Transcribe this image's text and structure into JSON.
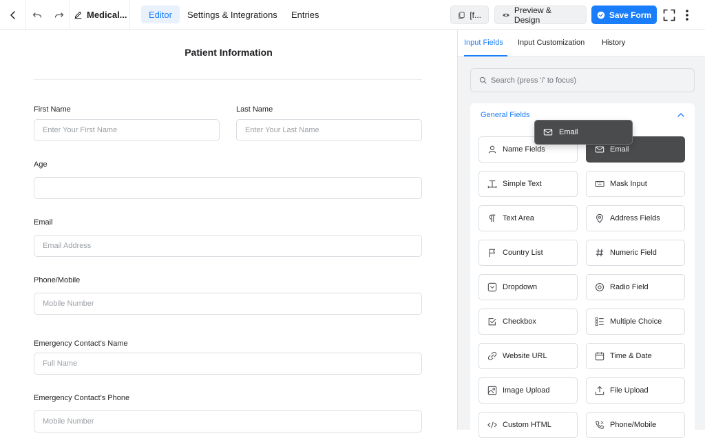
{
  "header": {
    "form_name": "Medical...",
    "tabs": [
      {
        "label": "Editor",
        "active": true
      },
      {
        "label": "Settings & Integrations",
        "active": false
      },
      {
        "label": "Entries",
        "active": false
      }
    ],
    "shortcode_label": "[f...",
    "preview_label": "Preview & Design",
    "save_label": "Save Form"
  },
  "form": {
    "title": "Patient Information",
    "fields": {
      "first_name": {
        "label": "First Name",
        "placeholder": "Enter Your First Name"
      },
      "last_name": {
        "label": "Last Name",
        "placeholder": "Enter Your Last Name"
      },
      "age": {
        "label": "Age",
        "placeholder": ""
      },
      "email": {
        "label": "Email",
        "placeholder": "Email Address"
      },
      "phone": {
        "label": "Phone/Mobile",
        "placeholder": "Mobile Number"
      },
      "emergency_name": {
        "label": "Emergency Contact's Name",
        "placeholder": "Full Name"
      },
      "emergency_phone": {
        "label": "Emergency Contact's Phone",
        "placeholder": "Mobile Number"
      }
    }
  },
  "panel": {
    "tabs": [
      {
        "label": "Input Fields",
        "active": true
      },
      {
        "label": "Input Customization",
        "active": false
      },
      {
        "label": "History",
        "active": false
      }
    ],
    "search_placeholder": "Search (press '/' to focus)",
    "group_title": "General Fields",
    "drag_ghost_label": "Email",
    "fields": [
      {
        "label": "Name Fields",
        "icon": "user-icon"
      },
      {
        "label": "Email",
        "icon": "envelope-icon",
        "selected": true
      },
      {
        "label": "Simple Text",
        "icon": "text-cursor-icon"
      },
      {
        "label": "Mask Input",
        "icon": "keyboard-icon"
      },
      {
        "label": "Text Area",
        "icon": "paragraph-icon"
      },
      {
        "label": "Address Fields",
        "icon": "map-pin-icon"
      },
      {
        "label": "Country List",
        "icon": "flag-icon"
      },
      {
        "label": "Numeric Field",
        "icon": "hash-icon"
      },
      {
        "label": "Dropdown",
        "icon": "dropdown-icon"
      },
      {
        "label": "Radio Field",
        "icon": "radio-icon"
      },
      {
        "label": "Checkbox",
        "icon": "checkbox-icon"
      },
      {
        "label": "Multiple Choice",
        "icon": "list-check-icon"
      },
      {
        "label": "Website URL",
        "icon": "link-icon"
      },
      {
        "label": "Time & Date",
        "icon": "calendar-icon"
      },
      {
        "label": "Image Upload",
        "icon": "image-icon"
      },
      {
        "label": "File Upload",
        "icon": "upload-icon"
      },
      {
        "label": "Custom HTML",
        "icon": "code-icon"
      },
      {
        "label": "Phone/Mobile",
        "icon": "phone-icon"
      }
    ]
  }
}
